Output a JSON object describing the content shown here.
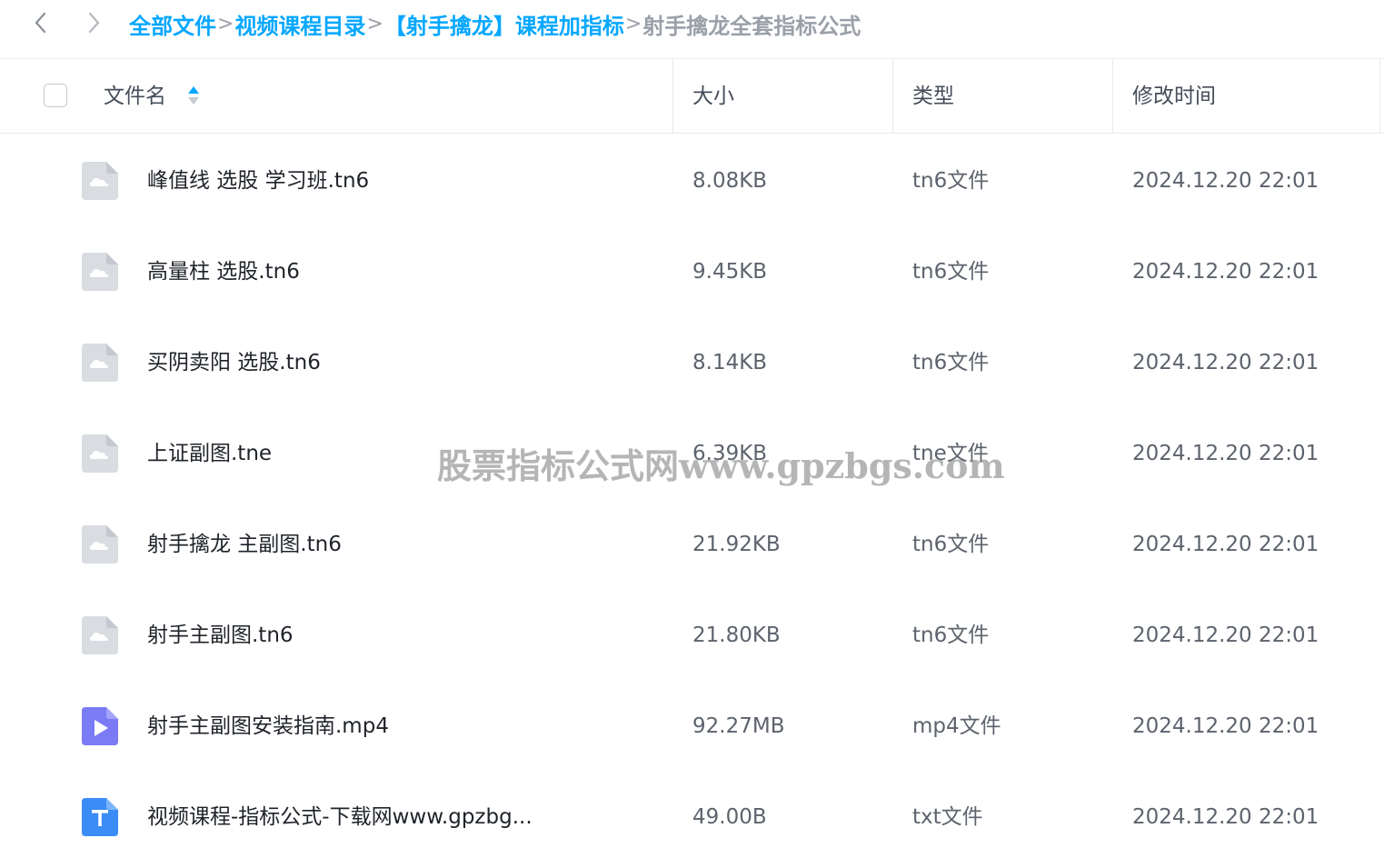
{
  "breadcrumb": {
    "items": [
      "全部文件",
      "视频课程目录",
      "【射手擒龙】课程加指标"
    ],
    "separator": ">",
    "current": "射手擒龙全套指标公式"
  },
  "table": {
    "columns": {
      "name": "文件名",
      "size": "大小",
      "type": "类型",
      "time": "修改时间"
    },
    "rows": [
      {
        "name": "峰值线 选股 学习班.tn6",
        "size": "8.08KB",
        "type": "tn6文件",
        "time": "2024.12.20 22:01",
        "icon": "generic-file-icon"
      },
      {
        "name": "高量柱 选股.tn6",
        "size": "9.45KB",
        "type": "tn6文件",
        "time": "2024.12.20 22:01",
        "icon": "generic-file-icon"
      },
      {
        "name": "买阴卖阳 选股.tn6",
        "size": "8.14KB",
        "type": "tn6文件",
        "time": "2024.12.20 22:01",
        "icon": "generic-file-icon"
      },
      {
        "name": "上证副图.tne",
        "size": "6.39KB",
        "type": "tne文件",
        "time": "2024.12.20 22:01",
        "icon": "generic-file-icon"
      },
      {
        "name": "射手擒龙 主副图.tn6",
        "size": "21.92KB",
        "type": "tn6文件",
        "time": "2024.12.20 22:01",
        "icon": "generic-file-icon"
      },
      {
        "name": "射手主副图.tn6",
        "size": "21.80KB",
        "type": "tn6文件",
        "time": "2024.12.20 22:01",
        "icon": "generic-file-icon"
      },
      {
        "name": "射手主副图安装指南.mp4",
        "size": "92.27MB",
        "type": "mp4文件",
        "time": "2024.12.20 22:01",
        "icon": "video-file-icon"
      },
      {
        "name": "视频课程-指标公式-下载网www.gpzbg...",
        "size": "49.00B",
        "type": "txt文件",
        "time": "2024.12.20 22:01",
        "icon": "text-file-icon"
      }
    ]
  },
  "watermark": "股票指标公式网www.gpzbgs.com",
  "colors": {
    "link": "#06a7ff",
    "muted": "#9aa0a8",
    "video_icon": "#7b7cf5",
    "text_icon": "#3b8cf6",
    "generic_icon": "#d9dce1"
  }
}
